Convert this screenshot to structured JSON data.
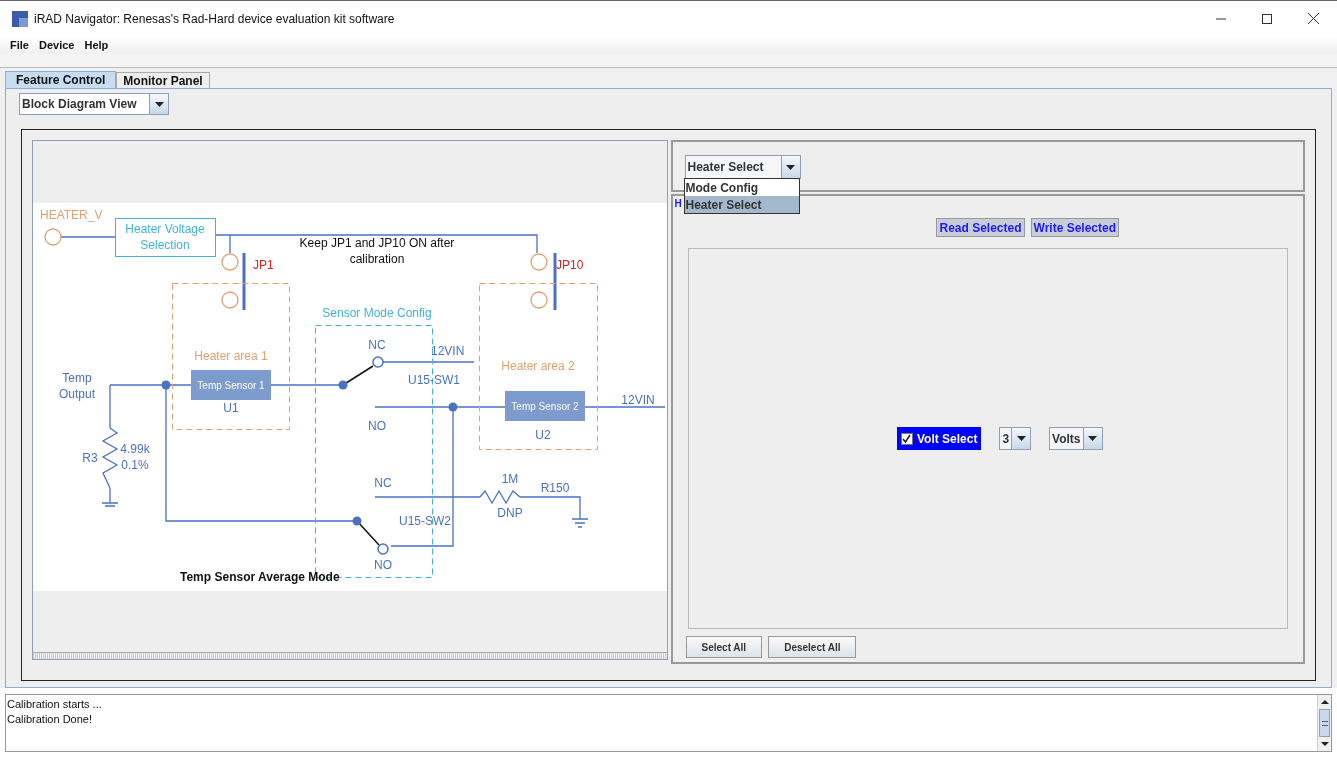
{
  "window": {
    "title": "iRAD Navigator: Renesas's Rad-Hard device evaluation kit software"
  },
  "menu": [
    "File",
    "Device",
    "Help"
  ],
  "tabs": [
    {
      "label": "Feature Control",
      "selected": true
    },
    {
      "label": "Monitor Panel",
      "selected": false
    }
  ],
  "view_selector": {
    "value": "Block Diagram View"
  },
  "block_diagram": {
    "labels": [
      {
        "lines": [
          "HEATER_V"
        ]
      },
      {
        "lines": [
          "Heater Voltage",
          "Selection"
        ]
      },
      {
        "lines": [
          "Keep JP1 and JP10 ON after",
          "calibration"
        ]
      },
      {
        "lines": [
          "JP1"
        ]
      },
      {
        "lines": [
          "JP10"
        ]
      },
      {
        "lines": [
          "Sensor Mode Config"
        ]
      },
      {
        "lines": [
          "NC"
        ]
      },
      {
        "lines": [
          "12VIN"
        ]
      },
      {
        "lines": [
          "Heater area 1"
        ]
      },
      {
        "lines": [
          "Heater area 2"
        ]
      },
      {
        "lines": [
          "Temp",
          "Output"
        ]
      },
      {
        "lines": [
          "Temp Sensor 1"
        ]
      },
      {
        "lines": [
          "U15-SW1"
        ]
      },
      {
        "lines": [
          "Temp Sensor 2"
        ]
      },
      {
        "lines": [
          "12VIN"
        ]
      },
      {
        "lines": [
          "U1"
        ]
      },
      {
        "lines": [
          "NO"
        ]
      },
      {
        "lines": [
          "U2"
        ]
      },
      {
        "lines": [
          "R3"
        ]
      },
      {
        "lines": [
          "4.99k",
          "0.1%"
        ]
      },
      {
        "lines": [
          "NC"
        ]
      },
      {
        "lines": [
          "1M"
        ]
      },
      {
        "lines": [
          "R150"
        ]
      },
      {
        "lines": [
          "DNP"
        ]
      },
      {
        "lines": [
          "U15-SW2"
        ]
      },
      {
        "lines": [
          "NO"
        ]
      },
      {
        "lines": [
          "Temp Sensor Average Mode"
        ]
      }
    ]
  },
  "mode_selector": {
    "value": "Heater Select",
    "expanded": true,
    "options": [
      {
        "label": "Mode Config",
        "selected": false
      },
      {
        "label": "Heater Select",
        "selected": true
      }
    ]
  },
  "group_title": "H",
  "actions": [
    "Read Selected",
    "Write Selected"
  ],
  "volt_select": {
    "label": "Volt Select",
    "checked": true,
    "count": "3",
    "unit": "Volts"
  },
  "selection_buttons": [
    "Select All",
    "Deselect All"
  ],
  "log": [
    "Calibration starts ...",
    "Calibration Done!"
  ]
}
